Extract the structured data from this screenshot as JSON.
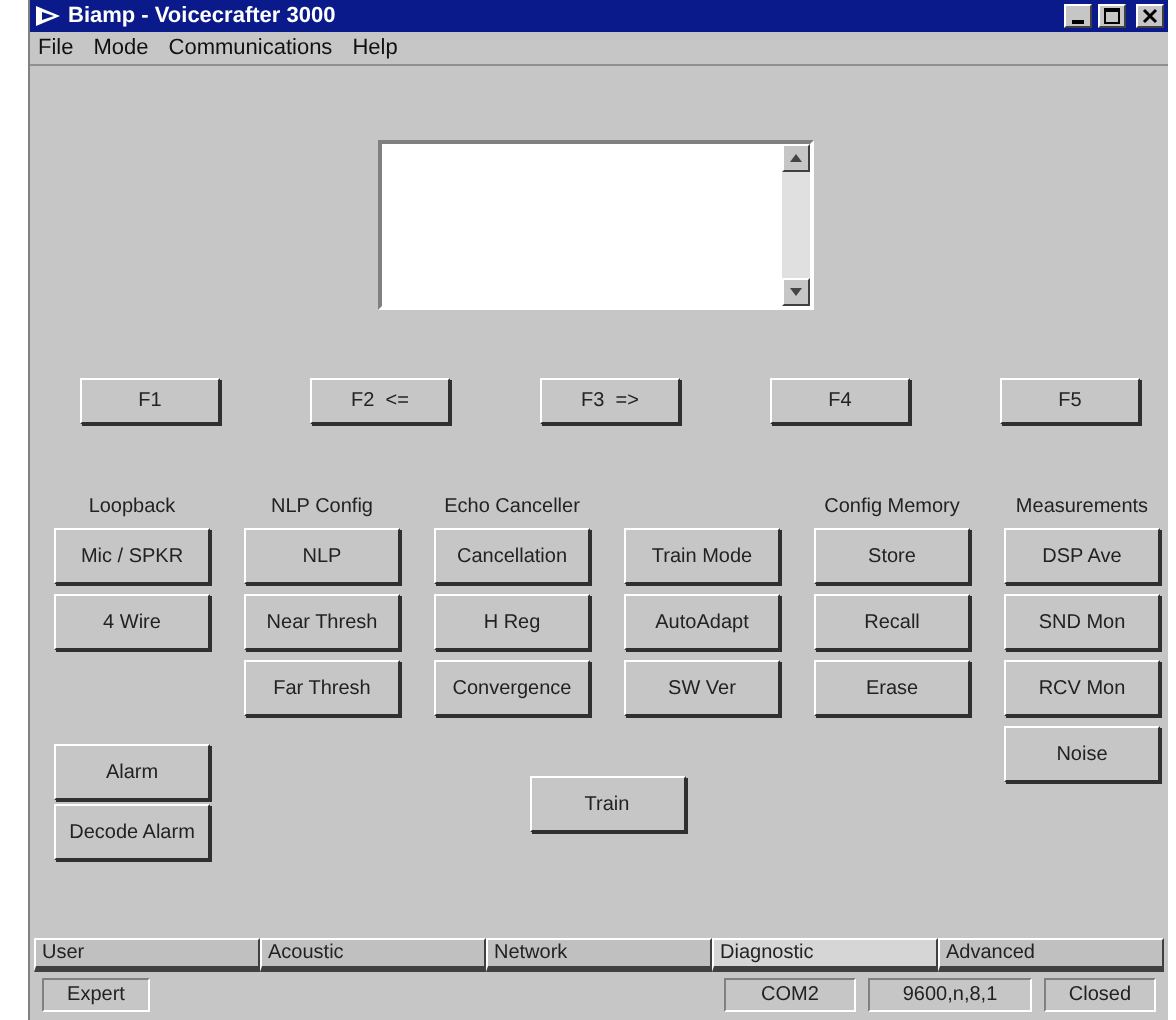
{
  "window": {
    "title": "Biamp - Voicecrafter 3000"
  },
  "menu": [
    "File",
    "Mode",
    "Communications",
    "Help"
  ],
  "function_keys": [
    "F1",
    "F2  <=",
    "F3  =>",
    "F4",
    "F5"
  ],
  "groups": [
    {
      "label": "Loopback",
      "buttons": [
        "Mic / SPKR",
        "4 Wire"
      ]
    },
    {
      "label": "NLP Config",
      "buttons": [
        "NLP",
        "Near Thresh",
        "Far Thresh"
      ]
    },
    {
      "label": "Echo Canceller",
      "buttons": [
        "Cancellation",
        "H Reg",
        "Convergence"
      ]
    },
    {
      "buttons": [
        "Train Mode",
        "AutoAdapt",
        "SW Ver"
      ]
    },
    {
      "label": "Config Memory",
      "buttons": [
        "Store",
        "Recall",
        "Erase"
      ]
    },
    {
      "label": "Measurements",
      "buttons": [
        "DSP Ave",
        "SND Mon",
        "RCV Mon",
        "Noise"
      ]
    }
  ],
  "alarm_buttons": [
    "Alarm",
    "Decode Alarm"
  ],
  "train_button": "Train",
  "tabs": [
    {
      "label": "User",
      "selected": false
    },
    {
      "label": "Acoustic",
      "selected": false
    },
    {
      "label": "Network",
      "selected": false
    },
    {
      "label": "Diagnostic",
      "selected": true
    },
    {
      "label": "Advanced",
      "selected": false
    }
  ],
  "status_bar": {
    "mode": "Expert",
    "port": "COM2",
    "settings": "9600,n,8,1",
    "connection": "Closed"
  }
}
